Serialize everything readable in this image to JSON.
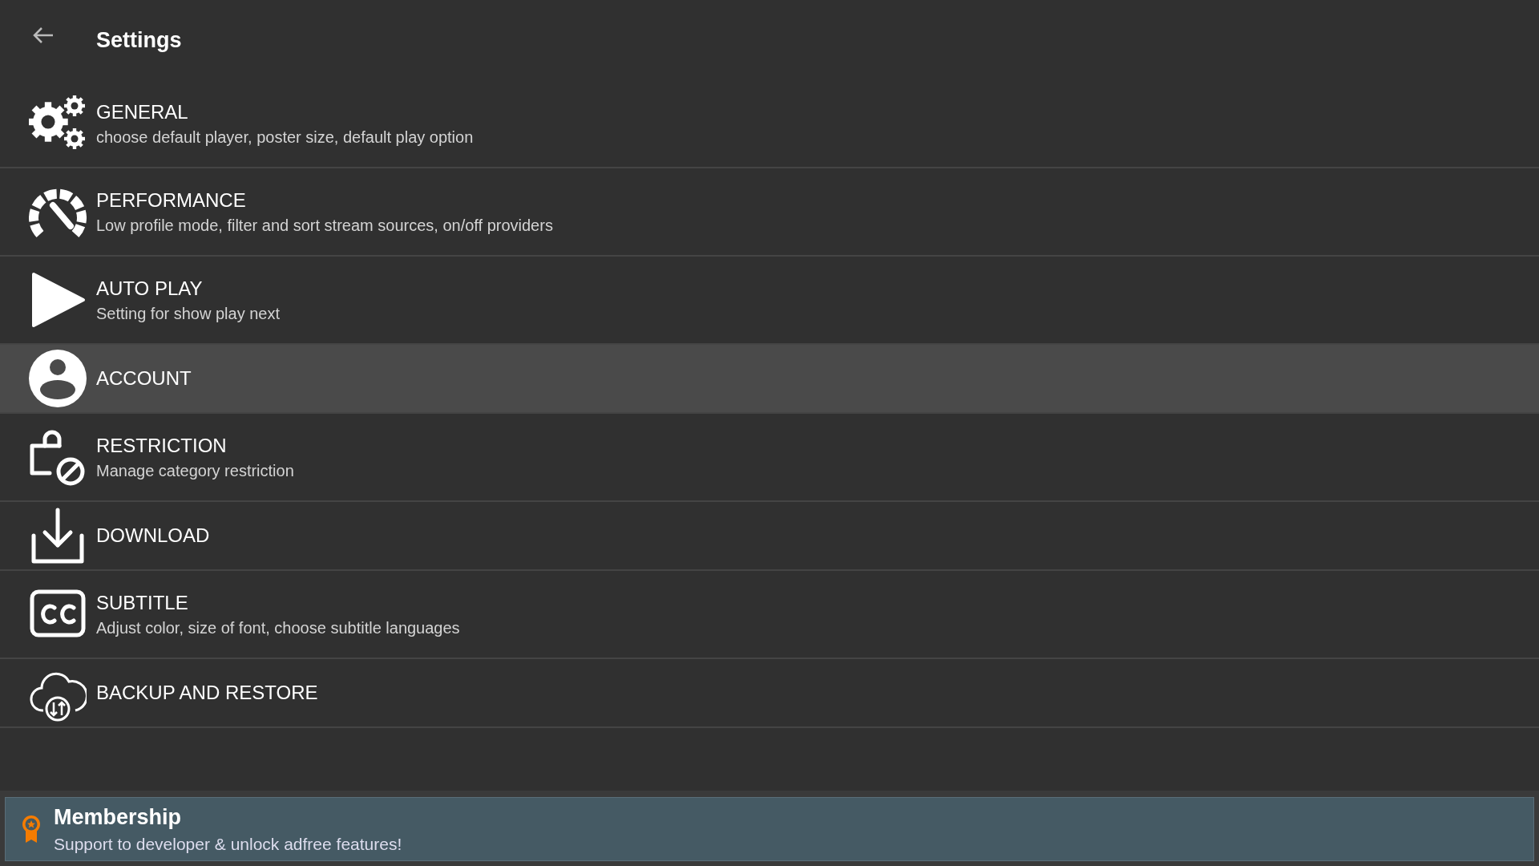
{
  "header": {
    "title": "Settings"
  },
  "items": [
    {
      "kind": "gears",
      "title": "GENERAL",
      "subtitle": "choose default player, poster size, default play option",
      "selected": false
    },
    {
      "kind": "gauge",
      "title": "PERFORMANCE",
      "subtitle": "Low profile mode, filter and sort stream sources, on/off providers",
      "selected": false
    },
    {
      "kind": "play",
      "title": "AUTO PLAY",
      "subtitle": "Setting for show play next",
      "selected": false
    },
    {
      "kind": "account",
      "title": "ACCOUNT",
      "selected": true
    },
    {
      "kind": "restriction",
      "title": "RESTRICTION",
      "subtitle": "Manage category restriction",
      "selected": false
    },
    {
      "kind": "download",
      "title": "DOWNLOAD",
      "selected": false
    },
    {
      "kind": "subtitle",
      "title": "SUBTITLE",
      "subtitle": "Adjust color, size of font, choose subtitle languages",
      "selected": false
    },
    {
      "kind": "backup",
      "title": "BACKUP AND RESTORE",
      "selected": false
    }
  ],
  "membership": {
    "title": "Membership",
    "subtitle": "Support to developer & unlock adfree features!"
  }
}
